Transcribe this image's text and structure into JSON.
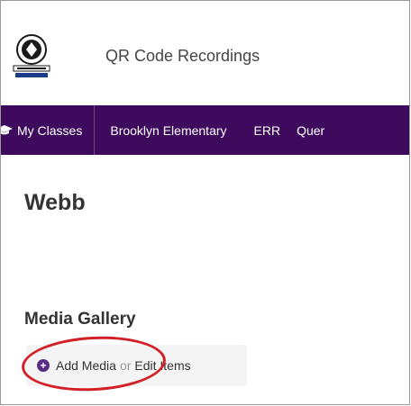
{
  "header": {
    "site_title": "QR Code Recordings",
    "logo_icon": "district-seal-logo-icon"
  },
  "nav": {
    "items": [
      {
        "label": "My Classes",
        "icon": "graduation-cap-icon"
      },
      {
        "label": "Brooklyn Elementary"
      },
      {
        "label": "ERR"
      },
      {
        "label": "Quer"
      }
    ],
    "background": "#3d0a5e"
  },
  "main": {
    "page_title": "Webb",
    "media_gallery": {
      "title": "Media Gallery",
      "add_media_label": "Add Media",
      "or_label": "or",
      "edit_items_label": "Edit Items",
      "plus_icon": "plus-circle-icon"
    }
  },
  "annotation": {
    "color": "#d31f26",
    "shape": "red-ellipse-highlight"
  }
}
